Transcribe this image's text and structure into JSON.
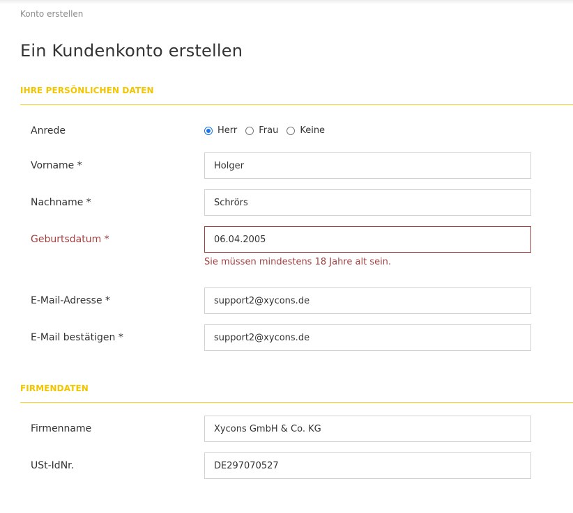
{
  "breadcrumb": "Konto erstellen",
  "page_title": "Ein Kundenkonto erstellen",
  "colors": {
    "accent": "#f2c500",
    "error": "#a04040",
    "radio_selected": "#1a73e8"
  },
  "personal": {
    "title": "IHRE PERSÖNLICHEN DATEN",
    "salutation": {
      "label": "Anrede",
      "options": [
        "Herr",
        "Frau",
        "Keine"
      ],
      "selected": "Herr"
    },
    "firstname": {
      "label": "Vorname *",
      "value": "Holger"
    },
    "lastname": {
      "label": "Nachname *",
      "value": "Schrörs"
    },
    "birthdate": {
      "label": "Geburtsdatum *",
      "value": "06.04.2005",
      "error": "Sie müssen mindestens 18 Jahre alt sein."
    },
    "email": {
      "label": "E-Mail-Adresse *",
      "value": "support2@xycons.de"
    },
    "email_confirm": {
      "label": "E-Mail bestätigen *",
      "value": "support2@xycons.de"
    }
  },
  "company": {
    "title": "FIRMENDATEN",
    "company_name": {
      "label": "Firmenname",
      "value": "Xycons GmbH & Co. KG"
    },
    "vat_id": {
      "label": "USt-IdNr.",
      "value": "DE297070527"
    }
  }
}
